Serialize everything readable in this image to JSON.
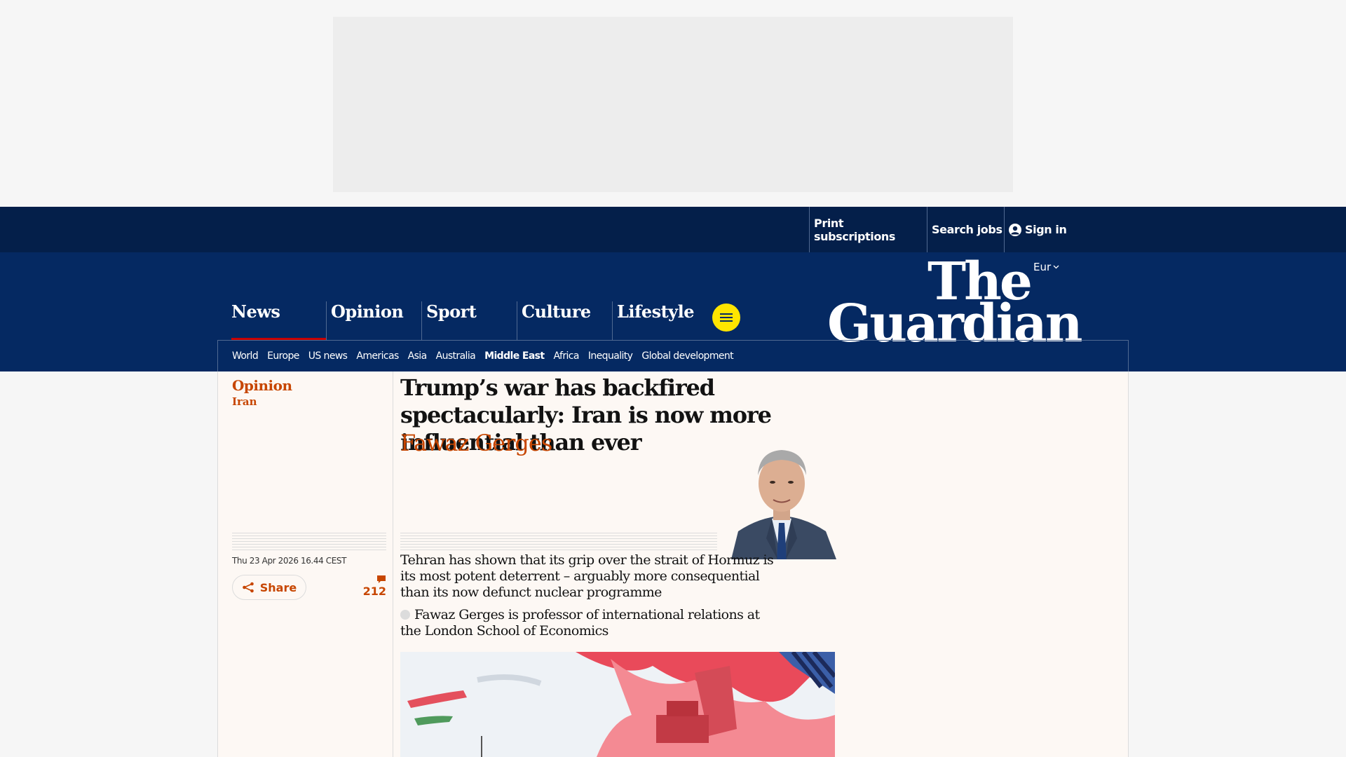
{
  "header": {
    "utility": {
      "print_subscriptions": "Print subscriptions",
      "search_jobs": "Search jobs",
      "sign_in": "Sign in"
    },
    "edition": "Eur",
    "logo": {
      "line1": "The",
      "line2": "Guardian"
    },
    "pillars": [
      "News",
      "Opinion",
      "Sport",
      "Culture",
      "Lifestyle"
    ],
    "active_pillar": "News",
    "subnav": [
      "World",
      "Europe",
      "US news",
      "Americas",
      "Asia",
      "Australia",
      "Middle East",
      "Africa",
      "Inequality",
      "Global development"
    ],
    "active_subnav": "Middle East"
  },
  "article": {
    "section": "Opinion",
    "series": "Iran",
    "headline": "Trump’s war has backfired spectacularly: Iran is now more influential than ever",
    "byline": "Fawaz Gerges",
    "standfirst": "Tehran has shown that its grip over the strait of Hormuz is its most potent deterrent – arguably more consequential than its now defunct nuclear programme",
    "bio": "Fawaz Gerges is professor of international relations at the London School of Economics",
    "dateline": "Thu 23 Apr 2026 16.44 CEST",
    "share_label": "Share",
    "comment_count": "212"
  },
  "colors": {
    "brand_dark": "#041f4a",
    "brand": "#052962",
    "opinion_accent": "#c74600",
    "menu_button": "#ffe500",
    "news_underline": "#c70000",
    "page_bg": "#fdf8f4"
  },
  "icons": {
    "sign_in": "user-circle-icon",
    "edition_toggle": "chevron-down-icon",
    "menu": "hamburger-icon",
    "share": "share-icon",
    "comments": "comment-icon"
  }
}
